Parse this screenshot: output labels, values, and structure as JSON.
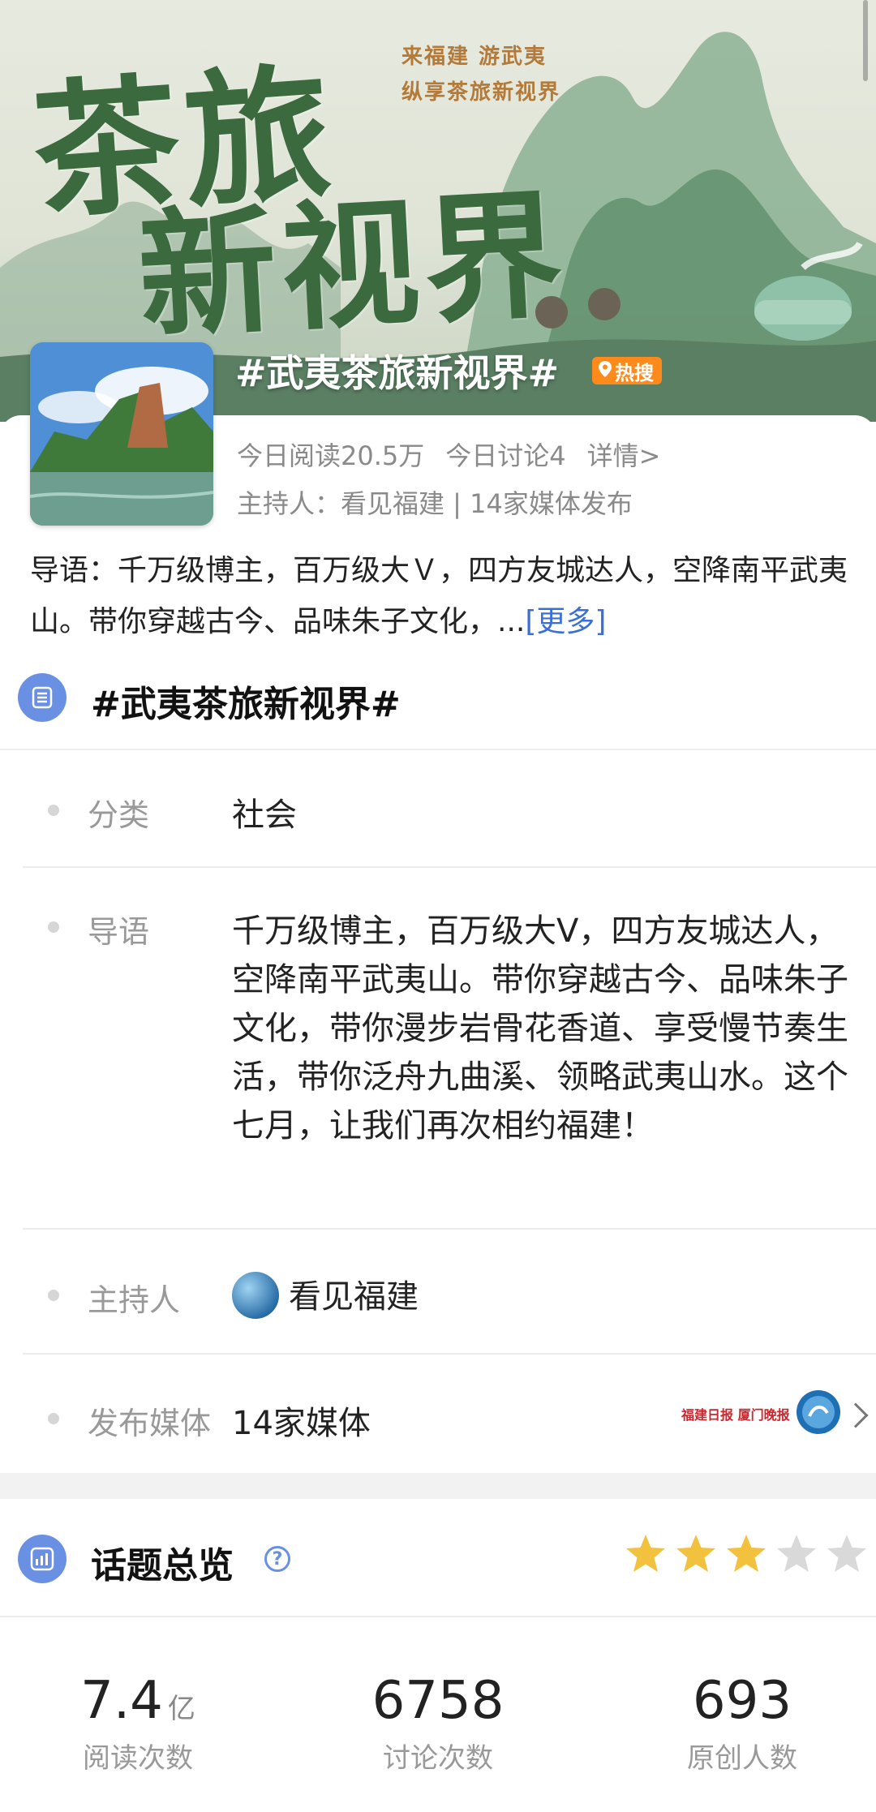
{
  "banner": {
    "title_line1": "茶旅",
    "title_line2": "新视界",
    "slogan_line1": "来福建 游武夷",
    "slogan_line2": "纵享茶旅新视界"
  },
  "topic": {
    "name": "#武夷茶旅新视界#",
    "hot_badge": "热搜",
    "today_reads": "今日阅读20.5万",
    "today_discuss": "今日讨论4",
    "details_link": "详情>",
    "host_line": "主持人：看见福建 | 14家媒体发布",
    "intro_short": "导语：千万级博主，百万级大Ｖ，四方友城达人，空降南平武夷山。带你穿越古今、品味朱子文化，...",
    "more_link": "[更多]"
  },
  "info_section": {
    "title": "#武夷茶旅新视界#",
    "category_label": "分类",
    "category_value": "社会",
    "intro_label": "导语",
    "intro_value": "千万级博主，百万级大V，四方友城达人，空降南平武夷山。带你穿越古今、品味朱子文化，带你漫步岩骨花香道、享受慢节奏生活，带你泛舟九曲溪、领略武夷山水。这个七月，让我们再次相约福建！",
    "host_label": "主持人",
    "host_value": "看见福建",
    "media_label": "发布媒体",
    "media_value": "14家媒体",
    "media_logo_text": "福建日报 厦门晚报"
  },
  "overview": {
    "title": "话题总览",
    "help_icon": "?",
    "rating": 3,
    "rating_max": 5,
    "colors": {
      "star_on": "#f2c13d",
      "star_off": "#d9d9d9"
    },
    "metrics": [
      {
        "value": "7.4",
        "unit": "亿",
        "label": "阅读次数"
      },
      {
        "value": "6758",
        "unit": "",
        "label": "讨论次数"
      },
      {
        "value": "693",
        "unit": "",
        "label": "原创人数"
      }
    ]
  }
}
